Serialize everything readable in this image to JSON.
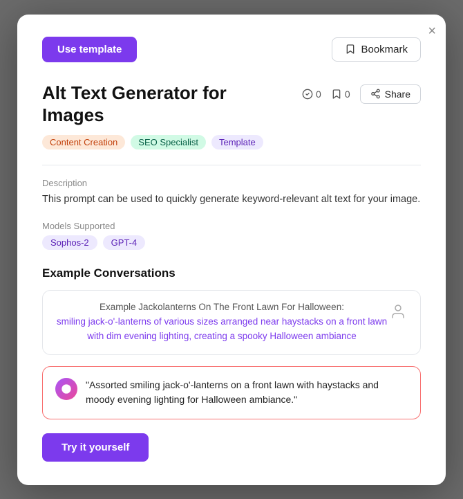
{
  "modal": {
    "close_label": "×",
    "use_template_label": "Use template",
    "bookmark_label": "Bookmark",
    "title": "Alt Text Generator for Images",
    "like_count": "0",
    "bookmark_count": "0",
    "share_label": "Share",
    "tags": [
      {
        "label": "Content Creation",
        "style": "content"
      },
      {
        "label": "SEO Specialist",
        "style": "seo"
      },
      {
        "label": "Template",
        "style": "template"
      }
    ],
    "description_label": "Description",
    "description_text": "This prompt can be used to quickly generate keyword-relevant alt text for your image.",
    "models_label": "Models Supported",
    "models": [
      {
        "label": "Sophos-2"
      },
      {
        "label": "GPT-4"
      }
    ],
    "example_conversations_heading": "Example Conversations",
    "conversation_prompt": "Example Jackolanterns On The Front Lawn For Halloween:",
    "conversation_link": "smiling jack-o'-lanterns of various sizes arranged near haystacks on a front lawn with dim evening lighting, creating a spooky Halloween ambiance",
    "response_text": "\"Assorted smiling jack-o'-lanterns on a front lawn with haystacks and moody evening lighting for Halloween ambiance.\"",
    "try_button_label": "Try it yourself"
  }
}
